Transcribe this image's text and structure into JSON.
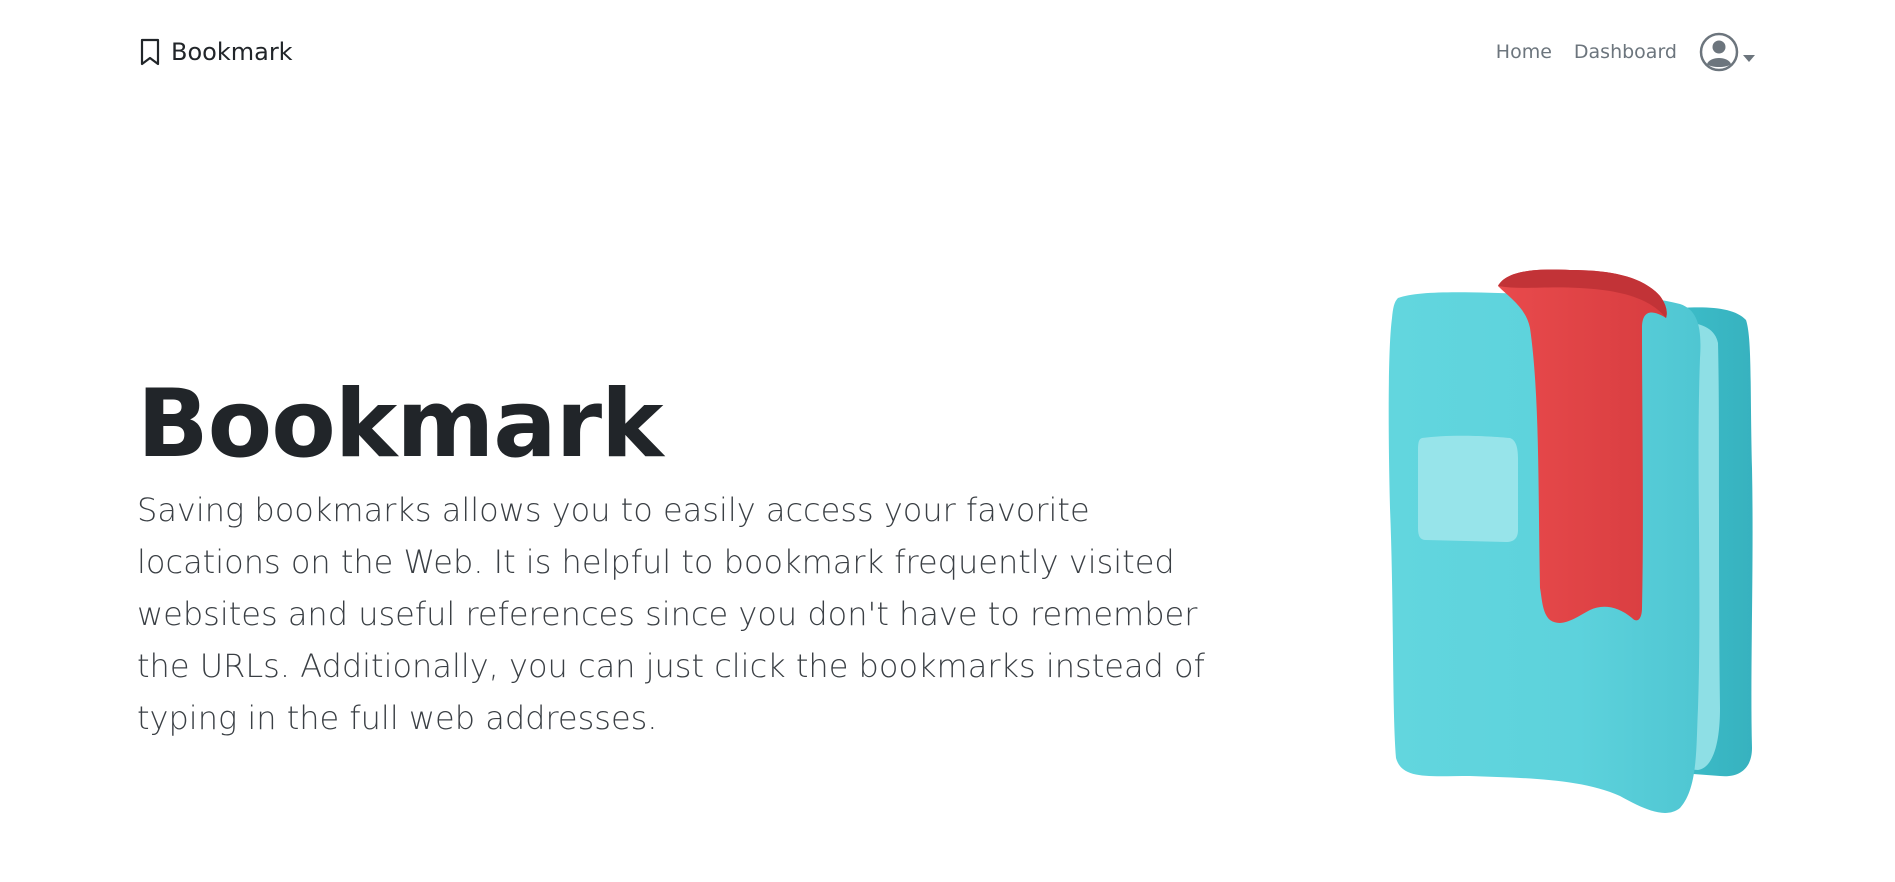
{
  "navbar": {
    "brand_icon": "bookmark-outline-icon",
    "brand_label": "Bookmark",
    "links": [
      {
        "label": "Home"
      },
      {
        "label": "Dashboard"
      }
    ],
    "profile_icon": "user-circle-icon",
    "profile_caret": "caret-down-icon"
  },
  "hero": {
    "title": "Bookmark",
    "description": "Saving bookmarks allows you to easily access your favorite locations on the Web. It is helpful to bookmark frequently visited websites and useful references since you don't have to remember the URLs. Additionally, you can just click the bookmarks instead of typing in the full web addresses.",
    "illustration": "clay-book-with-red-bookmark-illustration"
  },
  "colors": {
    "text": "#212529",
    "muted": "#6c757d",
    "book": "#5cd3dc",
    "ribbon": "#e4484a"
  }
}
